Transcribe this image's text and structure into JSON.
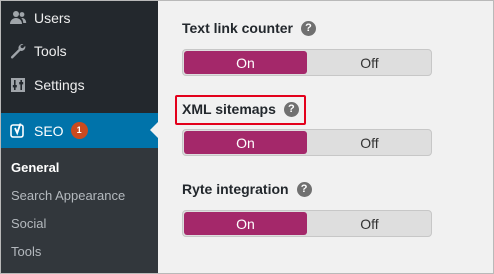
{
  "sidebar": {
    "items": [
      {
        "label": "Users",
        "icon": "users-icon"
      },
      {
        "label": "Tools",
        "icon": "wrench-icon"
      },
      {
        "label": "Settings",
        "icon": "settings-sliders-icon"
      },
      {
        "label": "SEO",
        "icon": "yoast-icon",
        "badge": "1"
      }
    ],
    "submenu": [
      {
        "label": "General"
      },
      {
        "label": "Search Appearance"
      },
      {
        "label": "Social"
      },
      {
        "label": "Tools"
      }
    ]
  },
  "main": {
    "fields": [
      {
        "label": "Text link counter",
        "help": "?",
        "on_label": "On",
        "off_label": "Off",
        "value": "On"
      },
      {
        "label": "XML sitemaps",
        "help": "?",
        "on_label": "On",
        "off_label": "Off",
        "value": "On"
      },
      {
        "label": "Ryte integration",
        "help": "?",
        "on_label": "On",
        "off_label": "Off",
        "value": "On"
      }
    ]
  },
  "colors": {
    "accent_on": "#a4286a",
    "highlight": "#e3001b",
    "sidebar_active": "#0073aa"
  }
}
